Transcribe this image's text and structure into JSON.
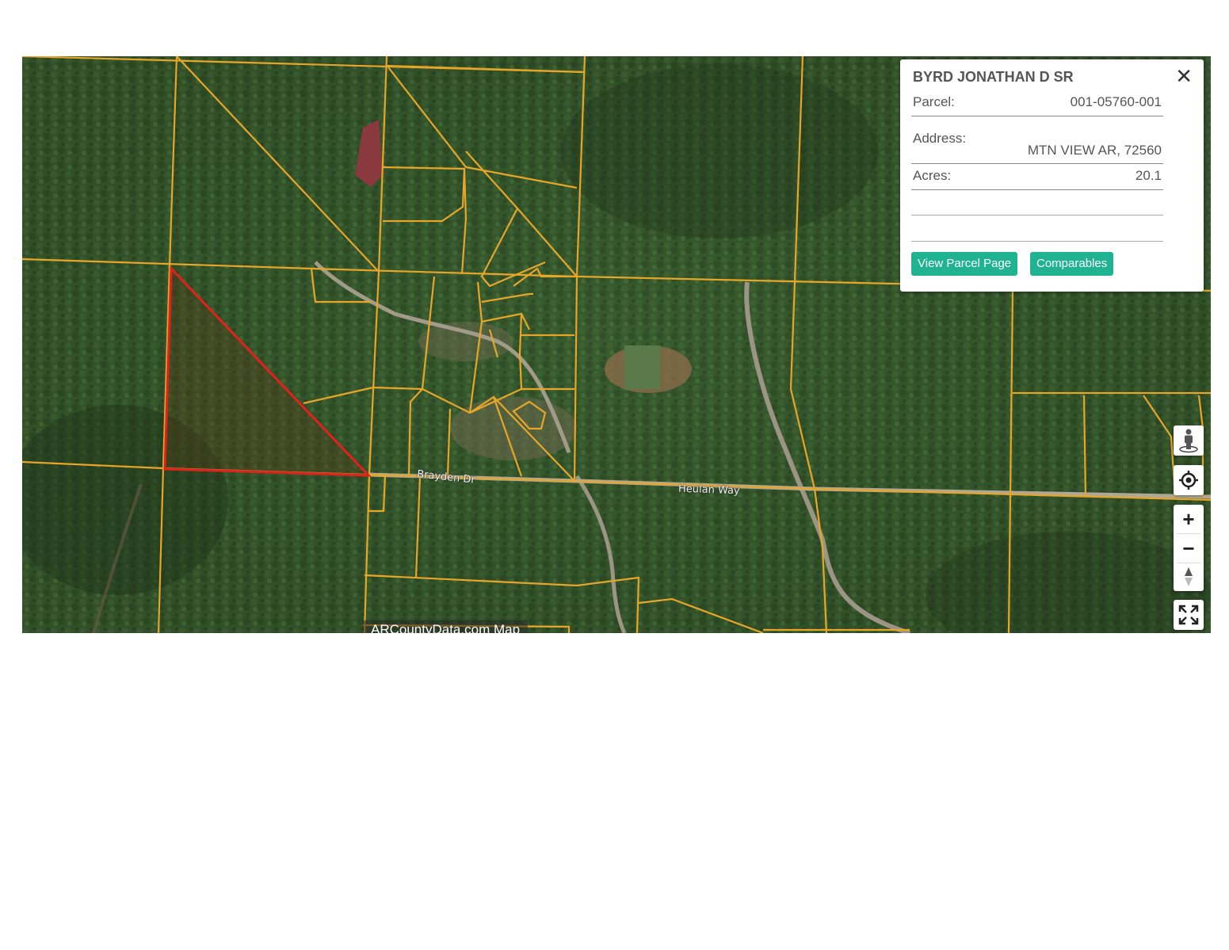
{
  "map": {
    "watermark": "ARCountyData.com Map",
    "roads": [
      "Brayden Dr",
      "Heulan Way"
    ],
    "colors": {
      "parcel_line": "#e8a628",
      "selected_parcel": "#e3211c",
      "forest": "#2f4d27",
      "button": "#1fb391"
    }
  },
  "popup": {
    "owner": "BYRD JONATHAN D SR",
    "parcel_label": "Parcel:",
    "parcel_value": "001-05760-001",
    "address_label": "Address:",
    "address_value": "MTN VIEW AR, 72560",
    "acres_label": "Acres:",
    "acres_value": "20.1",
    "close_icon": "close-icon",
    "view_button": "View Parcel Page",
    "comparables_button": "Comparables"
  },
  "controls": {
    "street_view_icon": "pegman-icon",
    "locate_icon": "crosshair-icon",
    "zoom_in_label": "+",
    "zoom_out_label": "−",
    "compass_icon": "compass-icon",
    "fullscreen_icon": "fullscreen-icon"
  }
}
